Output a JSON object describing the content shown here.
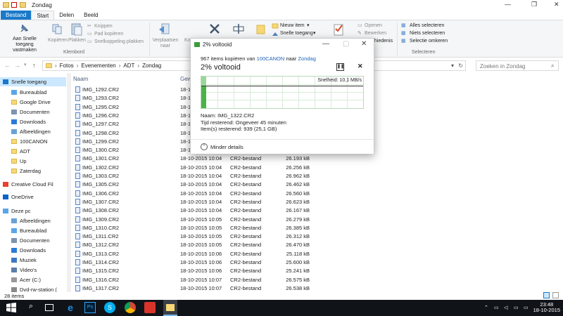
{
  "window": {
    "title": "Zondag"
  },
  "tabs": [
    {
      "label": "Bestand"
    },
    {
      "label": "Start"
    },
    {
      "label": "Delen"
    },
    {
      "label": "Beeld"
    }
  ],
  "ribbon": {
    "pin": "Aan Snelle toegang vastmaken",
    "copy": "Kopiëren",
    "paste": "Plakken",
    "cut": "Knippen",
    "copy_path": "Pad kopiëren",
    "paste_shortcut": "Snelkoppeling plakken",
    "clipboard_group": "Klembord",
    "move": "Verplaatsen naar",
    "copy_to": "Ko",
    "new_item": "Nieuw item",
    "easy_access": "Snelle toegang",
    "open": "Openen",
    "edit": "Bewerken",
    "history": "hiedenis",
    "select_all": "Alles selecteren",
    "select_none": "Niets selecteren",
    "invert_selection": "Selectie omkeren",
    "select_group": "Selecteren"
  },
  "addressbar": {
    "path": [
      "Fotos",
      "Evenementen",
      "ADT",
      "Zondag"
    ],
    "search_placeholder": "Zoeken in Zondag"
  },
  "nav": [
    {
      "label": "Snelle toegang",
      "icon": "star-icon",
      "selected": true
    },
    {
      "label": "Bureaublad",
      "icon": "desktop-icon"
    },
    {
      "label": "Google Drive",
      "icon": "folder-icon"
    },
    {
      "label": "Documenten",
      "icon": "documents-icon"
    },
    {
      "label": "Downloads",
      "icon": "download-icon"
    },
    {
      "label": "Afbeeldingen",
      "icon": "pictures-icon"
    },
    {
      "label": "100CANON",
      "icon": "folder-icon"
    },
    {
      "label": "ADT",
      "icon": "folder-icon"
    },
    {
      "label": "Up",
      "icon": "folder-icon"
    },
    {
      "label": "Zaterdag",
      "icon": "folder-icon"
    },
    {
      "label": "Creative Cloud Fil",
      "icon": "cloud-icon"
    },
    {
      "label": "OneDrive",
      "icon": "onedrive-icon"
    },
    {
      "label": "Deze pc",
      "icon": "pc-icon"
    },
    {
      "label": "Afbeeldingen",
      "icon": "pictures-icon"
    },
    {
      "label": "Bureaublad",
      "icon": "desktop-icon"
    },
    {
      "label": "Documenten",
      "icon": "documents-icon"
    },
    {
      "label": "Downloads",
      "icon": "download-icon"
    },
    {
      "label": "Muziek",
      "icon": "music-icon"
    },
    {
      "label": "Video's",
      "icon": "video-icon"
    },
    {
      "label": "Acer (C:)",
      "icon": "drive-icon"
    },
    {
      "label": "Dvd-rw-station (",
      "icon": "dvd-icon"
    }
  ],
  "columns": {
    "name": "Naam",
    "date": "Gew"
  },
  "files": [
    {
      "name": "IMG_1292.CR2",
      "date": "18-10",
      "type": "",
      "size": ""
    },
    {
      "name": "IMG_1293.CR2",
      "date": "18-10",
      "type": "",
      "size": ""
    },
    {
      "name": "IMG_1295.CR2",
      "date": "18-10",
      "type": "",
      "size": ""
    },
    {
      "name": "IMG_1296.CR2",
      "date": "18-10",
      "type": "",
      "size": ""
    },
    {
      "name": "IMG_1297.CR2",
      "date": "18-10",
      "type": "",
      "size": ""
    },
    {
      "name": "IMG_1298.CR2",
      "date": "18-10",
      "type": "",
      "size": ""
    },
    {
      "name": "IMG_1299.CR2",
      "date": "18-10",
      "type": "",
      "size": ""
    },
    {
      "name": "IMG_1300.CR2",
      "date": "18-10",
      "type": "",
      "size": ""
    },
    {
      "name": "IMG_1301.CR2",
      "date": "18-10-2015 10:04",
      "type": "CR2-bestand",
      "size": "26.193 kB"
    },
    {
      "name": "IMG_1302.CR2",
      "date": "18-10-2015 10:04",
      "type": "CR2-bestand",
      "size": "26.256 kB"
    },
    {
      "name": "IMG_1303.CR2",
      "date": "18-10-2015 10:04",
      "type": "CR2-bestand",
      "size": "26.962 kB"
    },
    {
      "name": "IMG_1305.CR2",
      "date": "18-10-2015 10:04",
      "type": "CR2-bestand",
      "size": "26.462 kB"
    },
    {
      "name": "IMG_1306.CR2",
      "date": "18-10-2015 10:04",
      "type": "CR2-bestand",
      "size": "26.560 kB"
    },
    {
      "name": "IMG_1307.CR2",
      "date": "18-10-2015 10:04",
      "type": "CR2-bestand",
      "size": "26.623 kB"
    },
    {
      "name": "IMG_1308.CR2",
      "date": "18-10-2015 10:04",
      "type": "CR2-bestand",
      "size": "26.167 kB"
    },
    {
      "name": "IMG_1309.CR2",
      "date": "18-10-2015 10:05",
      "type": "CR2-bestand",
      "size": "26.279 kB"
    },
    {
      "name": "IMG_1310.CR2",
      "date": "18-10-2015 10:05",
      "type": "CR2-bestand",
      "size": "26.385 kB"
    },
    {
      "name": "IMG_1311.CR2",
      "date": "18-10-2015 10:05",
      "type": "CR2-bestand",
      "size": "26.312 kB"
    },
    {
      "name": "IMG_1312.CR2",
      "date": "18-10-2015 10:05",
      "type": "CR2-bestand",
      "size": "26.470 kB"
    },
    {
      "name": "IMG_1313.CR2",
      "date": "18-10-2015 10:06",
      "type": "CR2-bestand",
      "size": "25.118 kB"
    },
    {
      "name": "IMG_1314.CR2",
      "date": "18-10-2015 10:06",
      "type": "CR2-bestand",
      "size": "25.600 kB"
    },
    {
      "name": "IMG_1315.CR2",
      "date": "18-10-2015 10:06",
      "type": "CR2-bestand",
      "size": "25.241 kB"
    },
    {
      "name": "IMG_1316.CR2",
      "date": "18-10-2015 10:07",
      "type": "CR2-bestand",
      "size": "26.575 kB"
    },
    {
      "name": "IMG_1317.CR2",
      "date": "18-10-2015 10:07",
      "type": "CR2-bestand",
      "size": "26.538 kB"
    }
  ],
  "status": {
    "count": "28 items"
  },
  "dialog": {
    "title": "2% voltooid",
    "summary_prefix": "967 items kopiëren van ",
    "source": "100CANON",
    "summary_mid": " naar ",
    "target": "Zondag",
    "percent": "2% voltooid",
    "progress": 0.02,
    "speed": "Snelheid: 10,1 MB/s",
    "name": "Naam: IMG_1322.CR2",
    "time_left": "Tijd resterend: Ongeveer 45 minuten",
    "items_left": "Item(s) resterend: 939 (25,1 GB)",
    "less_details": "Minder details"
  },
  "taskbar": {
    "time": "23:48",
    "date": "18-10-2015"
  },
  "colors": {
    "accent": "#1979ca",
    "progress": "#4ab348",
    "link": "#1c63b7",
    "taskbar": "#101419"
  }
}
